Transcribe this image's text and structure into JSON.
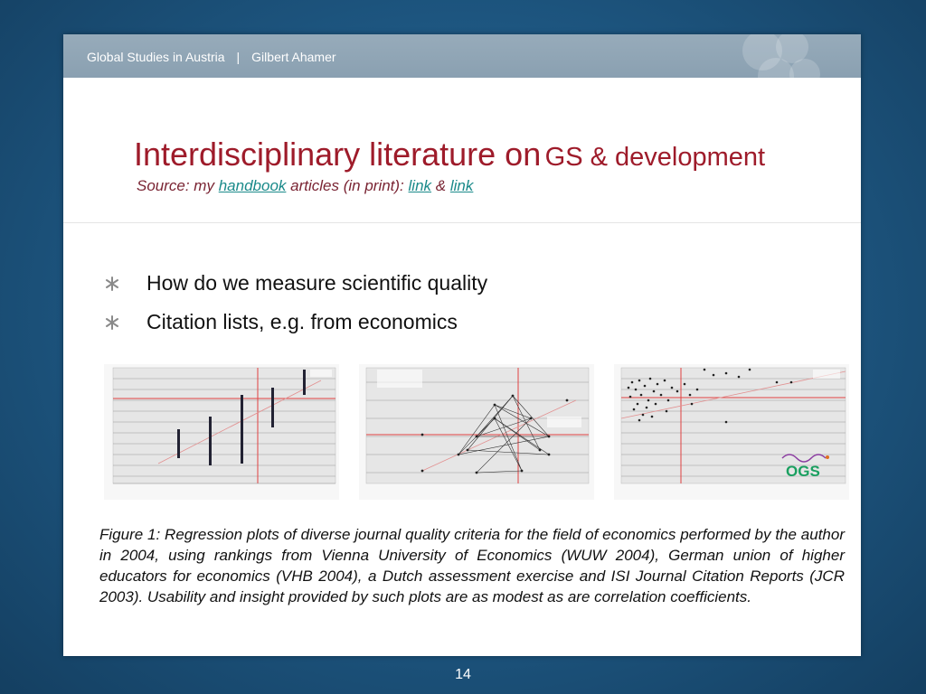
{
  "header": {
    "left": "Global Studies in Austria",
    "separator": "|",
    "right": "Gilbert Ahamer"
  },
  "title": {
    "part1": "Interdisciplinary literature on",
    "part2": "GS & development"
  },
  "subtitle": {
    "prefix": "Source: my",
    "link1": "handbook",
    "middle": "articles (in print):",
    "link2": "link",
    "amp": "&",
    "link3": "link"
  },
  "bullets": [
    "How do we measure scientific quality",
    "Citation lists, e.g. from economics"
  ],
  "figure": {
    "ogs_logo": "OGS",
    "caption": "Figure 1: Regression plots of diverse journal quality criteria for the field of economics performed by the author in 2004, using rankings from Vienna University of Economics (WUW 2004), German union of higher educators for economics (VHB 2004), a Dutch assessment exercise and ISI Journal Citation Reports (JCR 2003). Usability and insight provided by such plots are as modest as are correlation coefficients."
  },
  "page_number": "14",
  "colors": {
    "title": "#9e1b2a",
    "link": "#1a8a8a",
    "header_bar": "#8fa4b4",
    "plot_ref_line": "#e04040"
  }
}
